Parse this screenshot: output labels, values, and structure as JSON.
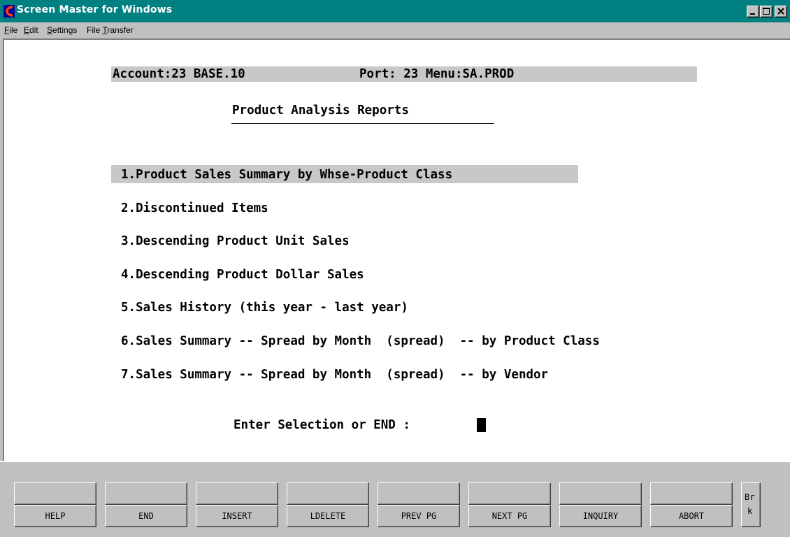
{
  "window": {
    "title": "Screen Master for Windows"
  },
  "menubar": {
    "file": {
      "accel": "F",
      "rest": "ile"
    },
    "edit": {
      "accel": "E",
      "rest": "dit"
    },
    "settings": {
      "accel": "S",
      "rest": "ettings"
    },
    "transfer": {
      "pre": "File ",
      "accel": "T",
      "rest": "ransfer"
    }
  },
  "status": {
    "account": "Account:23 BASE.10",
    "port_menu": "Port: 23 Menu:SA.PROD"
  },
  "screen": {
    "title": "Product Analysis Reports",
    "menu_items": [
      "1.Product Sales Summary by Whse-Product Class",
      "2.Discontinued Items",
      "3.Descending Product Unit Sales",
      "4.Descending Product Dollar Sales",
      "5.Sales History (this year - last year)",
      "6.Sales Summary -- Spread by Month  (spread)  -- by Product Class",
      "7.Sales Summary -- Spread by Month  (spread)  -- by Vendor"
    ],
    "prompt": "Enter Selection or END : "
  },
  "function_keys": {
    "top": [
      "",
      "",
      "",
      "",
      "",
      "",
      "",
      ""
    ],
    "bottom": [
      "HELP",
      "END",
      "INSERT",
      "LDELETE",
      "PREV PG",
      "NEXT PG",
      "INQUIRY",
      "ABORT"
    ],
    "break_key": {
      "line1": "Br",
      "line2": "k"
    }
  },
  "icons": {
    "app": "app-icon",
    "minimize": "minimize-icon",
    "maximize": "maximize-icon",
    "close": "close-icon"
  },
  "colors": {
    "titlebar": "#008080",
    "highlight": "#c8c8c8",
    "chrome": "#c0c0c0"
  }
}
